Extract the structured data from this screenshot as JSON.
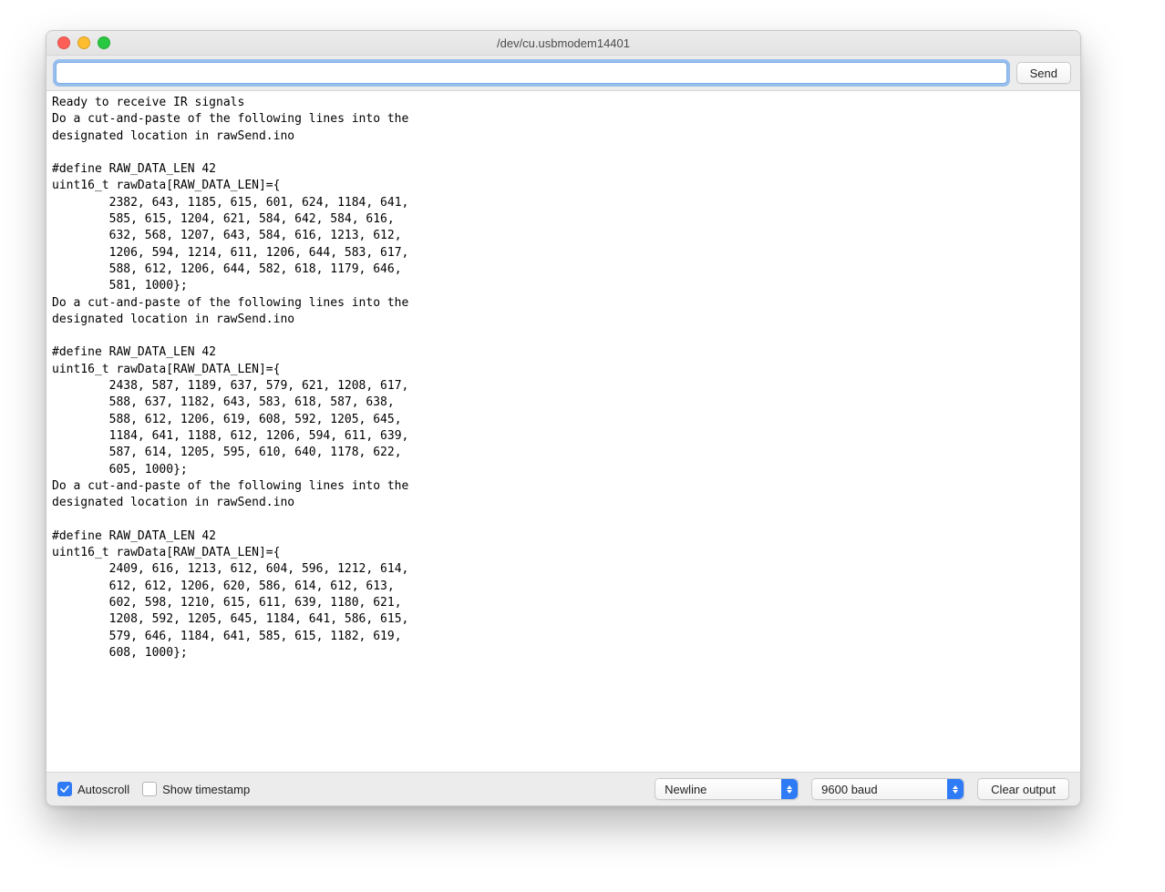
{
  "window": {
    "title": "/dev/cu.usbmodem14401"
  },
  "toolbar": {
    "send_label": "Send",
    "input_value": ""
  },
  "output": {
    "text": "Ready to receive IR signals\nDo a cut-and-paste of the following lines into the\ndesignated location in rawSend.ino\n\n#define RAW_DATA_LEN 42\nuint16_t rawData[RAW_DATA_LEN]={\n\t2382, 643, 1185, 615, 601, 624, 1184, 641, \n\t585, 615, 1204, 621, 584, 642, 584, 616, \n\t632, 568, 1207, 643, 584, 616, 1213, 612, \n\t1206, 594, 1214, 611, 1206, 644, 583, 617, \n\t588, 612, 1206, 644, 582, 618, 1179, 646, \n\t581, 1000};\nDo a cut-and-paste of the following lines into the\ndesignated location in rawSend.ino\n\n#define RAW_DATA_LEN 42\nuint16_t rawData[RAW_DATA_LEN]={\n\t2438, 587, 1189, 637, 579, 621, 1208, 617, \n\t588, 637, 1182, 643, 583, 618, 587, 638, \n\t588, 612, 1206, 619, 608, 592, 1205, 645, \n\t1184, 641, 1188, 612, 1206, 594, 611, 639, \n\t587, 614, 1205, 595, 610, 640, 1178, 622, \n\t605, 1000};\nDo a cut-and-paste of the following lines into the\ndesignated location in rawSend.ino\n\n#define RAW_DATA_LEN 42\nuint16_t rawData[RAW_DATA_LEN]={\n\t2409, 616, 1213, 612, 604, 596, 1212, 614, \n\t612, 612, 1206, 620, 586, 614, 612, 613, \n\t602, 598, 1210, 615, 611, 639, 1180, 621, \n\t1208, 592, 1205, 645, 1184, 641, 586, 615, \n\t579, 646, 1184, 641, 585, 615, 1182, 619, \n\t608, 1000};\n"
  },
  "footer": {
    "autoscroll_label": "Autoscroll",
    "autoscroll_checked": true,
    "timestamp_label": "Show timestamp",
    "timestamp_checked": false,
    "line_ending": "Newline",
    "baud": "9600 baud",
    "clear_label": "Clear output"
  }
}
